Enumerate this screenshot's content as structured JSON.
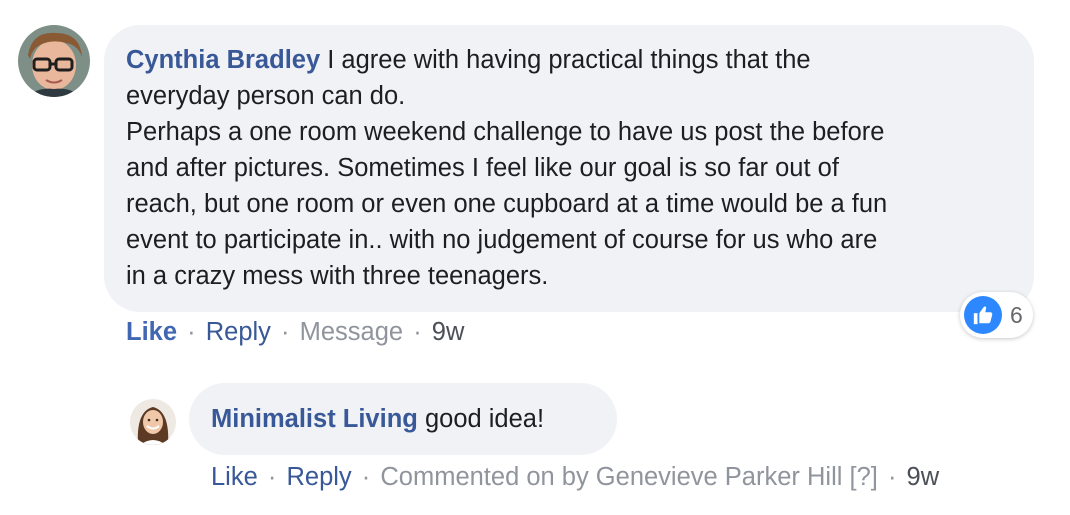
{
  "comment": {
    "author": "Cynthia Bradley",
    "lines": [
      "I agree with having practical things that the",
      "everyday person can do.",
      "Perhaps a one room weekend challenge to have us post the before",
      "and after pictures. Sometimes I feel like our goal is so far out of",
      "reach, but one room or even one cupboard at a time would be a fun",
      "event to participate in.. with no judgement of course for us who are",
      "in a crazy mess with three teenagers."
    ],
    "actions": {
      "like": "Like",
      "reply": "Reply",
      "message": "Message",
      "time": "9w",
      "separator": "·"
    },
    "reactions": {
      "icon": "thumbs-up-icon",
      "count": "6"
    }
  },
  "reply": {
    "author": "Minimalist Living",
    "text": "good idea!",
    "actions": {
      "like": "Like",
      "reply": "Reply",
      "commented_on_by": "Commented on by Genevieve Parker Hill",
      "help": "[?]",
      "time": "9w",
      "separator": "·"
    }
  },
  "colors": {
    "author": "#385898",
    "like_active": "#4267b2",
    "bubble": "#f0f2f5",
    "muted": "#90949c",
    "reaction_blue": "#2d88ff"
  }
}
